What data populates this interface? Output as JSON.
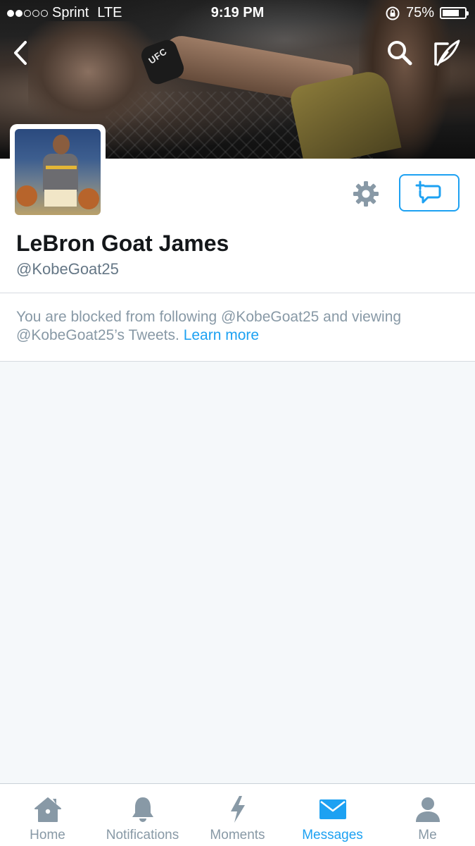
{
  "status_bar": {
    "carrier": "Sprint",
    "network": "LTE",
    "time": "9:19 PM",
    "battery_percent": "75%",
    "battery_level": 0.75,
    "signal_bars_filled": 2,
    "signal_bars_total": 5
  },
  "banner": {
    "glove_brand": "UFC"
  },
  "profile": {
    "display_name": "LeBron Goat James",
    "handle": "@KobeGoat25"
  },
  "blocked_notice": {
    "message": "You are blocked from following @KobeGoat25 and viewing @KobeGoat25’s Tweets.",
    "link_text": "Learn more"
  },
  "tabs": [
    {
      "label": "Home",
      "icon": "home-icon",
      "active": false
    },
    {
      "label": "Notifications",
      "icon": "bell-icon",
      "active": false
    },
    {
      "label": "Moments",
      "icon": "lightning-icon",
      "active": false
    },
    {
      "label": "Messages",
      "icon": "envelope-icon",
      "active": true
    },
    {
      "label": "Me",
      "icon": "person-icon",
      "active": false
    }
  ],
  "colors": {
    "accent": "#1da1f2",
    "muted": "#8899a6",
    "text": "#14171a",
    "background": "#f5f8fa"
  }
}
